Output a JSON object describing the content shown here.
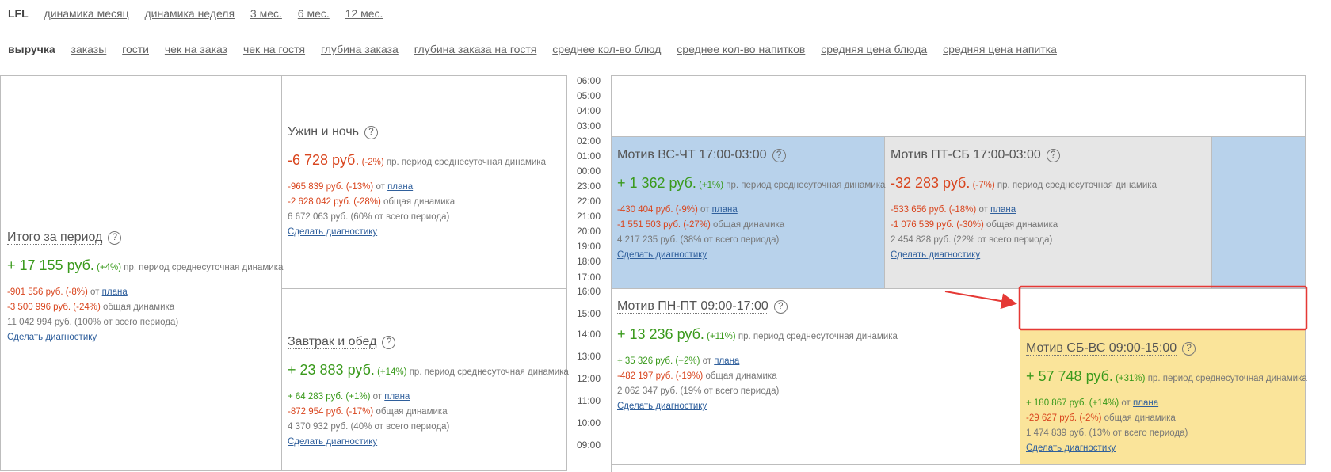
{
  "nav_top": [
    {
      "label": "LFL",
      "active": true
    },
    {
      "label": "динамика месяц"
    },
    {
      "label": "динамика неделя"
    },
    {
      "label": "3 мес."
    },
    {
      "label": "6 мес."
    },
    {
      "label": "12 мес."
    }
  ],
  "nav_metrics": [
    {
      "label": "выручка",
      "active": true
    },
    {
      "label": "заказы"
    },
    {
      "label": "гости"
    },
    {
      "label": "чек на заказ"
    },
    {
      "label": "чек на гостя"
    },
    {
      "label": "глубина заказа"
    },
    {
      "label": "глубина заказа на гостя"
    },
    {
      "label": "среднее кол-во блюд"
    },
    {
      "label": "среднее кол-во напитков"
    },
    {
      "label": "средняя цена блюда"
    },
    {
      "label": "средняя цена напитка"
    }
  ],
  "hours": [
    "06:00",
    "05:00",
    "04:00",
    "03:00",
    "02:00",
    "01:00",
    "00:00",
    "23:00",
    "22:00",
    "21:00",
    "20:00",
    "19:00",
    "18:00",
    "17:00",
    "16:00",
    "15:00",
    "14:00",
    "13:00",
    "12:00",
    "11:00",
    "10:00",
    "09:00"
  ],
  "common": {
    "help": "?",
    "period_note": "пр. период среднесуточная динамика",
    "plan_prefix": "от",
    "plan_link": "плана",
    "overall": "общая динамика",
    "diagnose": "Сделать диагностику"
  },
  "cards": {
    "total": {
      "title": "Итого за период",
      "main_value": "+ 17 155 руб.",
      "main_pct": "(+4%)",
      "plan_value": "-901 556 руб. (-8%)",
      "overall_value": "-3 500 996 руб. (-24%)",
      "share": "11 042 994 руб. (100% от всего периода)"
    },
    "dinner": {
      "title": "Ужин и ночь",
      "main_value": "-6 728 руб.",
      "main_pct": "(-2%)",
      "plan_value": "-965 839 руб. (-13%)",
      "overall_value": "-2 628 042 руб. (-28%)",
      "share": "6 672 063 руб. (60% от всего периода)"
    },
    "breakfast": {
      "title": "Завтрак и обед",
      "main_value": "+ 23 883 руб.",
      "main_pct": "(+14%)",
      "plan_value": "+ 64 283 руб. (+1%)",
      "overall_value": "-872 954 руб. (-17%)",
      "share": "4 370 932 руб. (40% от всего периода)"
    },
    "vs_cht": {
      "title": "Мотив ВС-ЧТ 17:00-03:00",
      "main_value": "+ 1 362 руб.",
      "main_pct": "(+1%)",
      "plan_value": "-430 404 руб. (-9%)",
      "overall_value": "-1 551 503 руб. (-27%)",
      "share": "4 217 235 руб. (38% от всего периода)"
    },
    "pt_sb": {
      "title": "Мотив ПТ-СБ 17:00-03:00",
      "main_value": "-32 283 руб.",
      "main_pct": "(-7%)",
      "plan_value": "-533 656 руб. (-18%)",
      "overall_value": "-1 076 539 руб. (-30%)",
      "share": "2 454 828 руб. (22% от всего периода)"
    },
    "pn_pt": {
      "title": "Мотив ПН-ПТ 09:00-17:00",
      "main_value": "+ 13 236 руб.",
      "main_pct": "(+11%)",
      "plan_value": "+ 35 326 руб. (+2%)",
      "overall_value": "-482 197 руб. (-19%)",
      "share": "2 062 347 руб. (19% от всего периода)"
    },
    "sb_vs": {
      "title": "Мотив СБ-ВС 09:00-15:00",
      "main_value": "+ 57 748 руб.",
      "main_pct": "(+31%)",
      "plan_value": "+ 180 867 руб. (+14%)",
      "overall_value": "-29 627 руб. (-2%)",
      "share": "1 474 839 руб. (13% от всего периода)"
    }
  },
  "colors": {
    "positive": "#3a9a1c",
    "negative": "#d9461f",
    "blue_cell": "#b8d2eb",
    "gray_cell": "#e6e6e6",
    "yellow_cell": "#fae49a",
    "annotation": "#e53935"
  }
}
